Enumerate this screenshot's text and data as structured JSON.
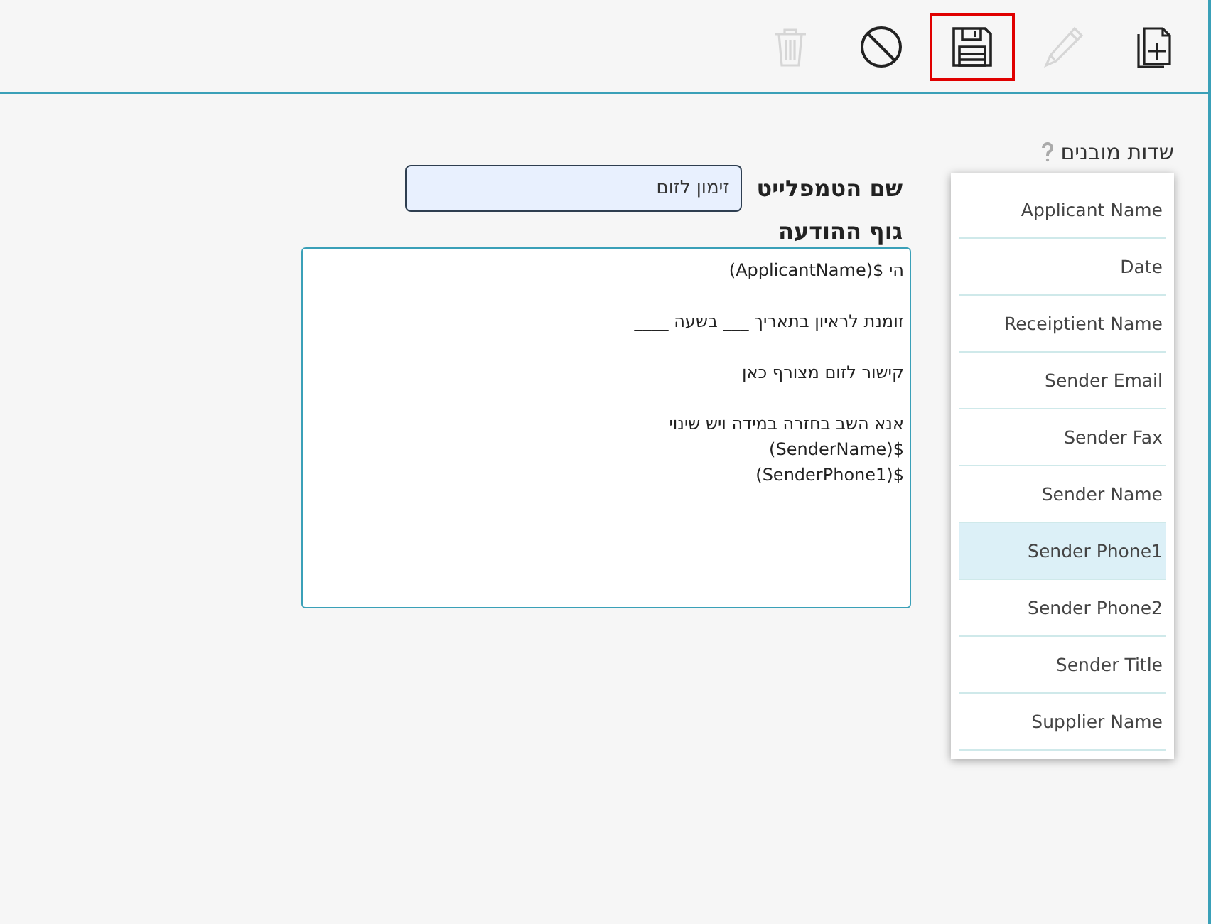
{
  "toolbar": [
    {
      "kind": "trash",
      "disabled": true,
      "highlighted": false
    },
    {
      "kind": "cancel",
      "disabled": false,
      "highlighted": false
    },
    {
      "kind": "save",
      "disabled": false,
      "highlighted": true
    },
    {
      "kind": "edit",
      "disabled": true,
      "highlighted": false
    },
    {
      "kind": "new",
      "disabled": false,
      "highlighted": false
    }
  ],
  "form": {
    "name_label": "שם הטמפלייט",
    "name_value": "זימון לזום",
    "body_label": "גוף ההודעה",
    "body_paragraphs": [
      [
        "הי $(ApplicantName)"
      ],
      [
        "זומנת לראיון בתאריך ___ בשעה ____"
      ],
      [
        "קישור לזום מצורף כאן"
      ],
      [
        "אנא השב בחזרה במידה ויש שינוי",
        "$(SenderName)",
        "$(SenderPhone1)"
      ]
    ]
  },
  "fields_panel": {
    "title": "שדות מובנים",
    "items": [
      {
        "label": "Applicant Name",
        "selected": false
      },
      {
        "label": "Date",
        "selected": false
      },
      {
        "label": "Receiptient Name",
        "selected": false
      },
      {
        "label": "Sender Email",
        "selected": false
      },
      {
        "label": "Sender Fax",
        "selected": false
      },
      {
        "label": "Sender Name",
        "selected": false
      },
      {
        "label": "Sender Phone1",
        "selected": true
      },
      {
        "label": "Sender Phone2",
        "selected": false
      },
      {
        "label": "Sender Title",
        "selected": false
      },
      {
        "label": "Supplier Name",
        "selected": false
      }
    ]
  }
}
